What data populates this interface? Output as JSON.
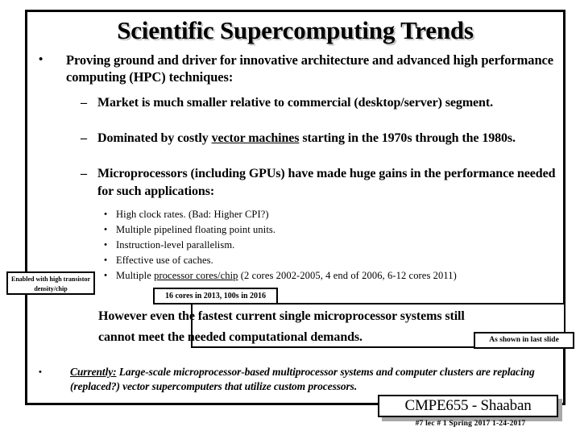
{
  "slide": {
    "title": "Scientific Supercomputing Trends",
    "bullets": {
      "level1": {
        "marker": "•",
        "text": "Proving ground and driver for innovative architecture and advanced high performance computing (HPC) techniques:"
      },
      "level2": [
        {
          "marker": "–",
          "text": "Market is much smaller relative to commercial (desktop/server) segment."
        },
        {
          "marker": "–",
          "text_before": "Dominated by costly ",
          "underlined": "vector machines",
          "text_after": " starting in the 1970s through the 1980s."
        },
        {
          "marker": "–",
          "text": "Microprocessors (including GPUs) have made huge gains in the performance needed for such applications:"
        }
      ],
      "level3": [
        {
          "marker": "•",
          "text": "High clock rates.     (Bad:  Higher CPI?)"
        },
        {
          "marker": "•",
          "text": "Multiple pipelined floating point units."
        },
        {
          "marker": "•",
          "text": "Instruction-level parallelism."
        },
        {
          "marker": "•",
          "text": "Effective use of caches."
        },
        {
          "marker": "•",
          "text_before": "Multiple ",
          "underlined": "processor cores/chip",
          "text_after": "  (2 cores 2002-2005, 4 end of 2006, 6-12 cores 2011)"
        }
      ]
    },
    "callouts": {
      "transistor_density": "Enabled with high transistor density/chip",
      "cores_note": "16 cores in 2013, 100s in 2016",
      "last_slide": "As shown in last slide",
      "however": "However even the fastest current single microprocessor systems still cannot meet the needed computational demands."
    },
    "currently": {
      "marker": "•",
      "label": "Currently:",
      "text": "  Large-scale microprocessor-based  multiprocessor systems and computer clusters are replacing (replaced?) vector supercomputers that utilize custom processors."
    },
    "footer": {
      "course": "CMPE655 - Shaaban",
      "meta": "#7  lec # 1  Spring 2017  1-24-2017"
    },
    "colors": {
      "text": "#000000",
      "background": "#ffffff",
      "title_shadow": "#c8c8c8",
      "footer_shadow": "#a8a8a8"
    }
  }
}
